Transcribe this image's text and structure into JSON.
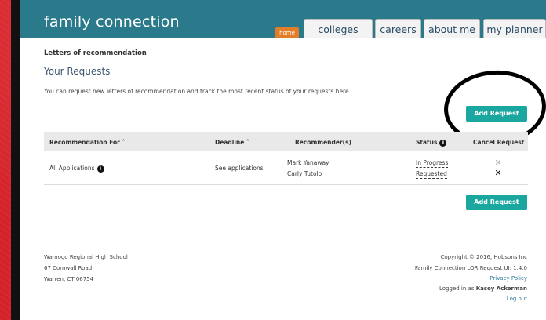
{
  "brand": "family connection",
  "tabs": {
    "home": "home",
    "colleges": "colleges",
    "careers": "careers",
    "about_me": "about me",
    "my_planner": "my planner"
  },
  "breadcrumb": "Letters of recommendation",
  "page_title": "Your Requests",
  "description": "You can request new letters of recommendation and track the most recent status of your requests here.",
  "add_request_label": "Add Request",
  "table": {
    "headers": {
      "recommendation_for": "Recommendation For ˄",
      "deadline": "Deadline ˄",
      "recommenders": "Recommender(s)",
      "status": "Status",
      "cancel": "Cancel Request"
    },
    "row": {
      "recommendation_for": "All Applications",
      "deadline": "See applications",
      "recommenders": [
        "Mark Yanaway",
        "Carly Tutolo"
      ],
      "statuses": [
        "In Progress",
        "Requested"
      ]
    }
  },
  "footer": {
    "school": "Wamogo Regional High School",
    "address1": "67 Cornwall Road",
    "address2": "Warren, CT 06754",
    "copyright": "Copyright © 2016, Hobsons Inc",
    "version": "Family Connection LOR Request UI: 1.4.0",
    "privacy": "Privacy Policy",
    "logged_prefix": "Logged in as",
    "user": "Kasey Ackerman",
    "logout": "Log out"
  },
  "colors": {
    "header": "#2a7a8c",
    "accent_button": "#1aa7a0",
    "home_tab": "#e27d28",
    "background": "#d4222a"
  }
}
